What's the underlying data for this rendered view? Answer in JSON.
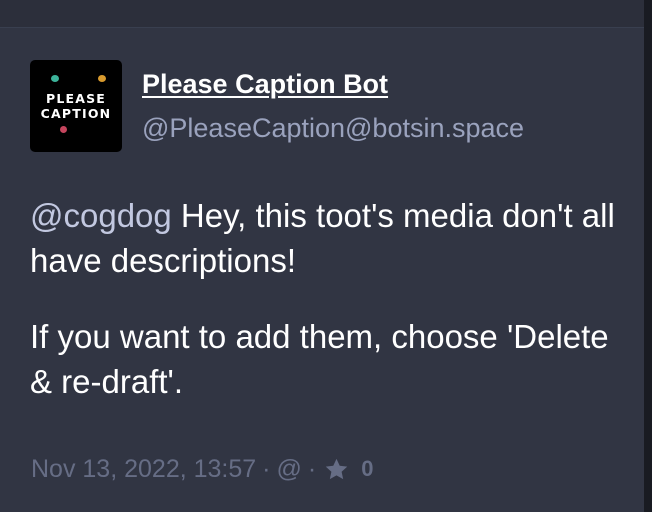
{
  "post": {
    "author": {
      "display_name": "Please Caption Bot",
      "handle": "@PleaseCaption@botsin.space",
      "avatar_text_line1": "PLEASE",
      "avatar_text_line2": "CAPTION"
    },
    "content": {
      "mention": "@cogdog",
      "paragraph1_rest": " Hey, this toot's media don't all have descriptions!",
      "paragraph2": "If you want to add them, choose 'Delete & re-draft'."
    },
    "meta": {
      "timestamp": "Nov 13, 2022, 13:57",
      "separator": "·",
      "visibility_symbol": "@",
      "favourites_count": "0"
    }
  },
  "colors": {
    "background": "#313543",
    "text": "#ffffff",
    "handle": "#9aa2bd",
    "mention": "#c2c8e0",
    "meta": "#666d85"
  },
  "icons": {
    "favourite": "star-icon",
    "visibility": "at-icon"
  }
}
